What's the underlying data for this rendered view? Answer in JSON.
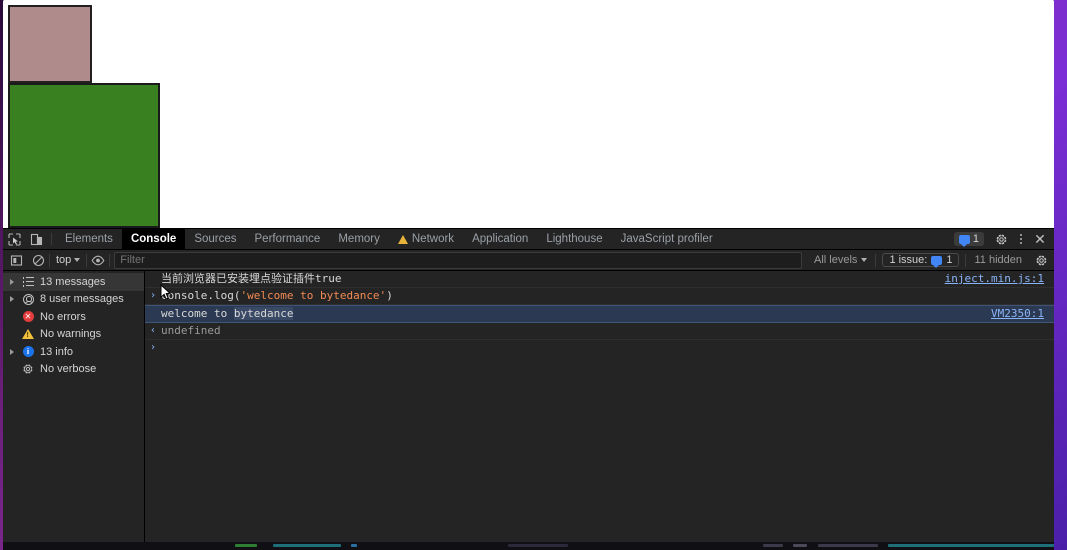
{
  "page": {
    "boxes": [
      {
        "name": "mauve-box",
        "color": "#b08b8b",
        "border": "#231f20"
      },
      {
        "name": "green-box",
        "color": "#398020",
        "border": "#1a1a1a"
      }
    ]
  },
  "devtools": {
    "tabs": [
      {
        "label": "Elements",
        "active": false,
        "warning": false
      },
      {
        "label": "Console",
        "active": true,
        "warning": false
      },
      {
        "label": "Sources",
        "active": false,
        "warning": false
      },
      {
        "label": "Performance",
        "active": false,
        "warning": false
      },
      {
        "label": "Memory",
        "active": false,
        "warning": false
      },
      {
        "label": "Network",
        "active": false,
        "warning": true
      },
      {
        "label": "Application",
        "active": false,
        "warning": false
      },
      {
        "label": "Lighthouse",
        "active": false,
        "warning": false
      },
      {
        "label": "JavaScript profiler",
        "active": false,
        "warning": false
      }
    ],
    "tabbar_right": {
      "issue_count": "1",
      "icons": [
        "message-icon",
        "gear-icon",
        "kebab-menu-icon",
        "close-icon"
      ]
    },
    "console_toolbar": {
      "context": "top",
      "filter_placeholder": "Filter",
      "filter_value": "",
      "levels": "All levels",
      "issues_label": "1 issue:",
      "issues_count": "1",
      "hidden_label": "11 hidden",
      "icons": [
        "sidebar-toggle-icon",
        "clear-console-icon",
        "eye-icon",
        "settings-gear-icon"
      ]
    },
    "sidebar": [
      {
        "label": "13 messages",
        "icon": "list-icon",
        "expandable": true,
        "selected": true
      },
      {
        "label": "8 user messages",
        "icon": "user-icon",
        "expandable": true,
        "selected": false
      },
      {
        "label": "No errors",
        "icon": "error-icon",
        "expandable": false,
        "selected": false
      },
      {
        "label": "No warnings",
        "icon": "warning-icon",
        "expandable": false,
        "selected": false
      },
      {
        "label": "13 info",
        "icon": "info-icon",
        "expandable": true,
        "selected": false
      },
      {
        "label": "No verbose",
        "icon": "verbose-gear-icon",
        "expandable": false,
        "selected": false
      }
    ],
    "messages": {
      "info_line": "当前浏览器已安装埋点验证插件true",
      "info_source": "inject.min.js:1",
      "command_prefix": "console.log(",
      "command_string": "'welcome to bytedance'",
      "command_suffix": ")",
      "output_text_a": "welcome to ",
      "output_text_b": "bytedance",
      "output_source": "VM2350:1",
      "return_value": "undefined",
      "prompt_caret": "›",
      "input_caret": "›",
      "return_caret": "‹"
    }
  }
}
